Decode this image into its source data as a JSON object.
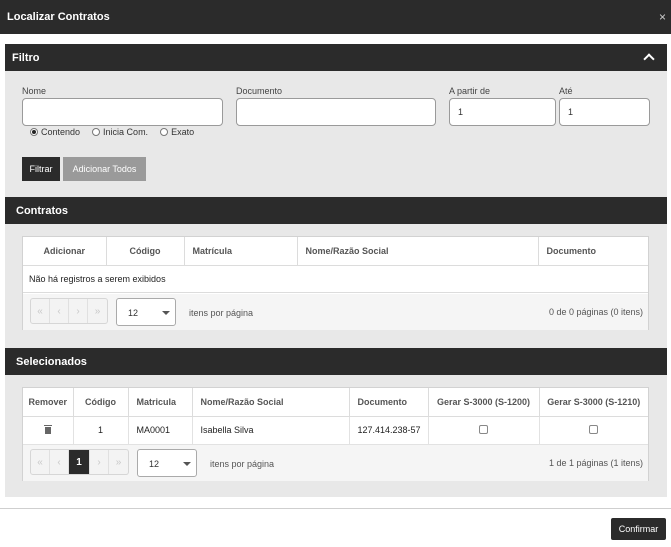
{
  "modal": {
    "title": "Localizar Contratos",
    "close_symbol": "×"
  },
  "filtro": {
    "title": "Filtro",
    "nome_label": "Nome",
    "nome_value": "",
    "documento_label": "Documento",
    "documento_value": "",
    "apartir_label": "A partir de",
    "apartir_value": "1",
    "ate_label": "Até",
    "ate_value": "1",
    "radios": [
      {
        "label": "Contendo",
        "selected": true
      },
      {
        "label": "Inicia Com.",
        "selected": false
      },
      {
        "label": "Exato",
        "selected": false
      }
    ],
    "filtrar_label": "Filtrar",
    "adicionar_todos_label": "Adicionar Todos"
  },
  "contratos": {
    "title": "Contratos",
    "columns": [
      "Adicionar",
      "Código",
      "Matrícula",
      "Nome/Razão Social",
      "Documento"
    ],
    "empty_text": "Não há registros a serem exibidos",
    "pager": {
      "buttons": [
        "«",
        "‹",
        "›",
        "»"
      ],
      "page_size": "12",
      "page_size_label": "itens por página",
      "info": "0 de 0 páginas (0 itens)"
    }
  },
  "selecionados": {
    "title": "Selecionados",
    "columns": [
      "Remover",
      "Código",
      "Matricula",
      "Nome/Razão Social",
      "Documento",
      "Gerar S-3000 (S-1200)",
      "Gerar S-3000 (S-1210)"
    ],
    "rows": [
      {
        "codigo": "1",
        "matricula": "MA0001",
        "nome": "Isabella Silva",
        "documento": "127.414.238-57",
        "gerar_1200": false,
        "gerar_1210": false
      }
    ],
    "pager": {
      "buttons": [
        "«",
        "‹",
        "1",
        "›",
        "»"
      ],
      "current_page": "1",
      "page_size": "12",
      "page_size_label": "itens por página",
      "info": "1 de 1 páginas (1 itens)"
    }
  },
  "footer": {
    "confirmar_label": "Confirmar"
  }
}
